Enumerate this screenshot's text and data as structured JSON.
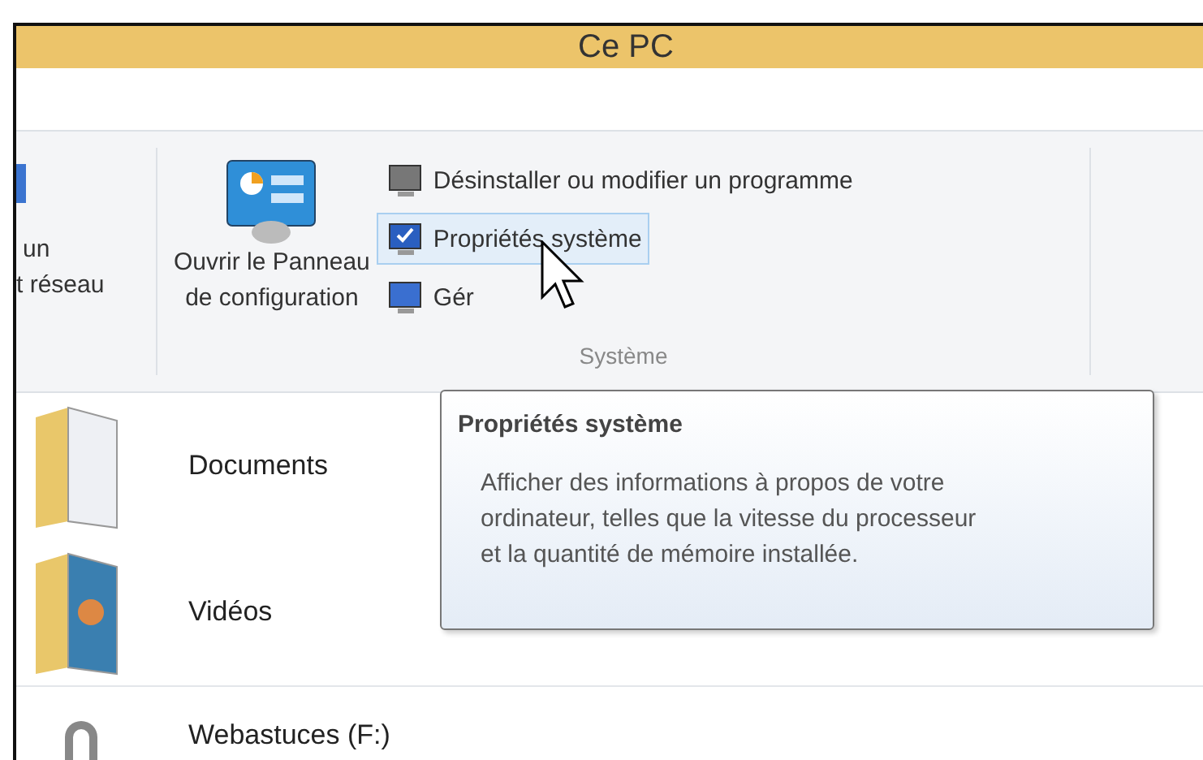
{
  "window": {
    "title": "Ce PC"
  },
  "ribbon": {
    "partial_group": {
      "lines": [
        "un",
        "t réseau"
      ]
    },
    "group": {
      "label": "Système",
      "large_button": {
        "lines": [
          "Ouvrir le Panneau",
          "de configuration"
        ]
      },
      "items": [
        {
          "label": "Désinstaller ou modifier un programme",
          "selected": false
        },
        {
          "label": "Propriétés système",
          "selected": true
        },
        {
          "label": "Gér",
          "selected": false
        }
      ]
    }
  },
  "items": [
    {
      "kind": "documents",
      "label": "Documents"
    },
    {
      "kind": "videos",
      "label": "Vidéos"
    },
    {
      "kind": "drive",
      "label": "Webastuces (F:)"
    }
  ],
  "tooltip": {
    "title": "Propriétés système",
    "body": "Afficher des informations à propos de votre ordinateur, telles que la vitesse du processeur et la quantité de mémoire installée."
  }
}
